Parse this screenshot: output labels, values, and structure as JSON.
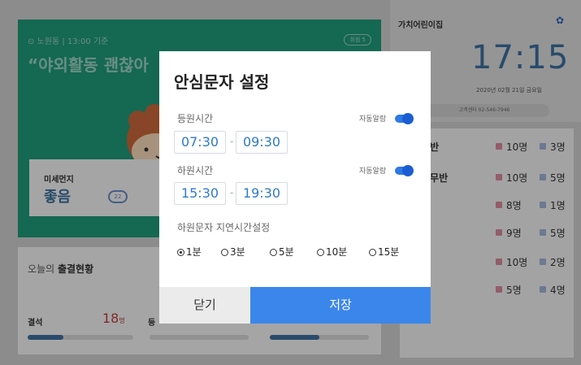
{
  "weather": {
    "location": "⊙ 노원동 | 13:00 기준",
    "headline": "“야외활동 괜찮아",
    "tag": "취침 5"
  },
  "dust": {
    "label": "미세먼지",
    "value": "좋음",
    "level": "22"
  },
  "attendance": {
    "title_prefix": "오늘의",
    "title_bold": "출결현황",
    "absent_label": "결석",
    "absent_value": "18",
    "absent_unit": "명",
    "second_label": "등",
    "absent_bar_fraction": 0.34,
    "second_bar_fraction": 0.5
  },
  "right": {
    "center_name": "가치어린이집",
    "clock": "17:15",
    "date": "2020년 02월 21일 금요일",
    "phone": "고객센터 02-546-7946",
    "classes": [
      {
        "name": "리반",
        "c1": "10명",
        "c2": "3명"
      },
      {
        "name": "나무반",
        "c1": "10명",
        "c2": "5명"
      },
      {
        "name": "반",
        "c1": "8명",
        "c2": "1명"
      },
      {
        "name": "반",
        "c1": "9명",
        "c2": "5명"
      },
      {
        "name": "반",
        "c1": "10명",
        "c2": "2명"
      },
      {
        "name": "반",
        "c1": "5명",
        "c2": "4명"
      }
    ]
  },
  "modal": {
    "title": "안심문자 설정",
    "arrival": {
      "label": "등원시간",
      "auto_label": "자동알람",
      "start": "07:30",
      "end": "09:30",
      "auto_on": true
    },
    "departure": {
      "label": "하원시간",
      "auto_label": "자동알람",
      "start": "15:30",
      "end": "19:30",
      "auto_on": true
    },
    "delay_label": "하원문자 지연시간설정",
    "delay_options": [
      "1분",
      "3분",
      "5분",
      "10분",
      "15분"
    ],
    "delay_selected": "1분",
    "close_label": "닫기",
    "save_label": "저장"
  },
  "colors": {
    "accent": "#3b86ea",
    "weather_green": "#1f9a79",
    "time_text": "#2f79c9"
  }
}
